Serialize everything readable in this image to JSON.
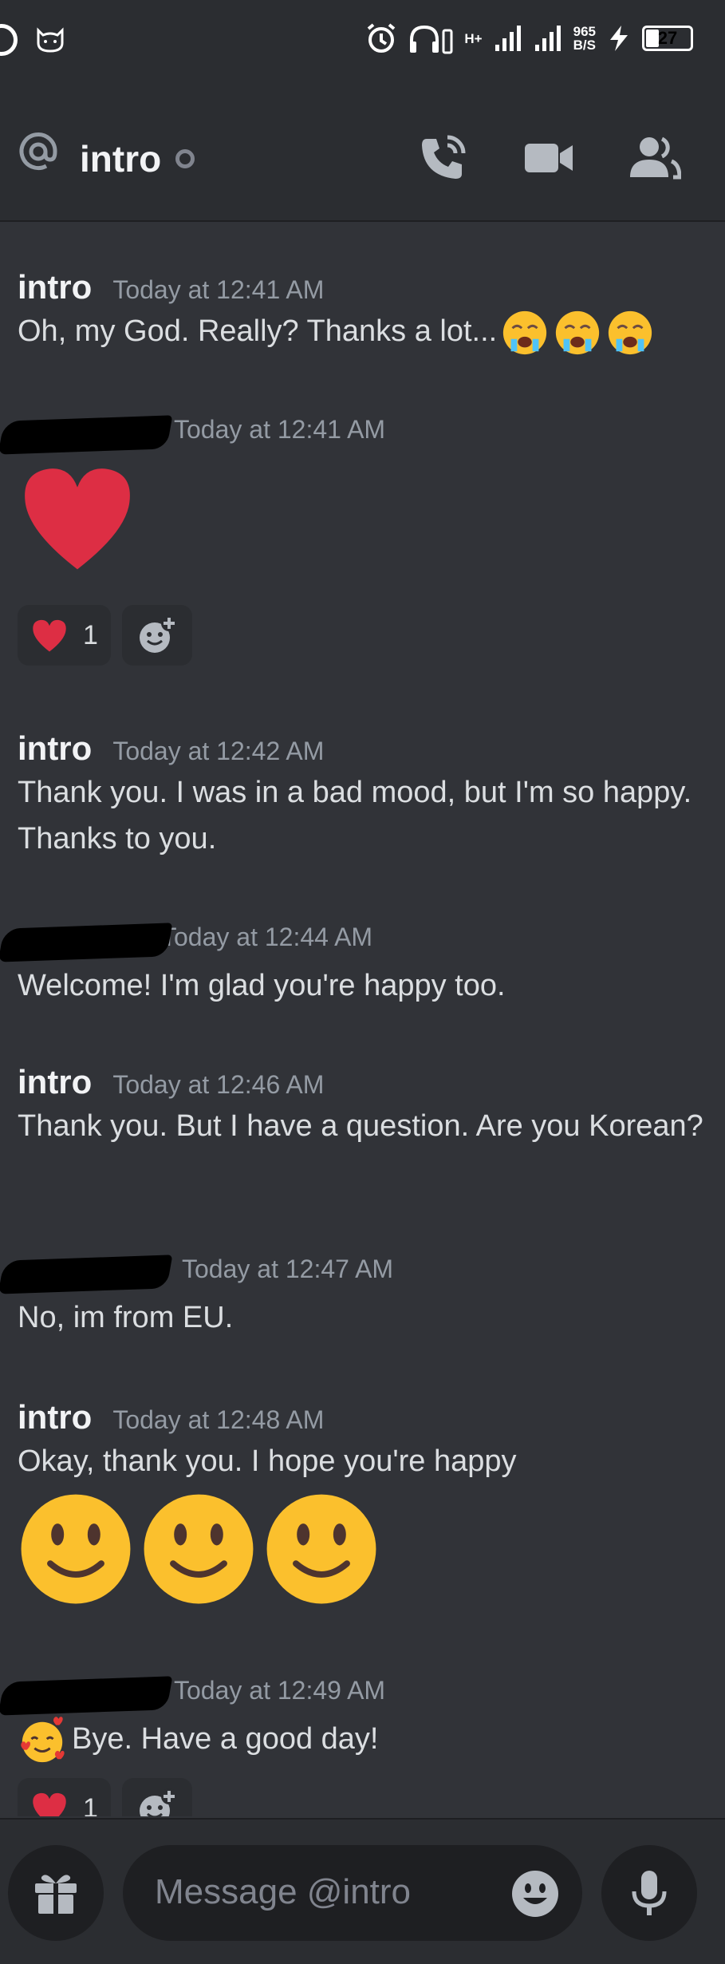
{
  "status_bar": {
    "net_speed": "965",
    "net_unit": "B/S",
    "network_type": "H+",
    "battery": "27"
  },
  "header": {
    "channel_name": "intro"
  },
  "messages": [
    {
      "author": "intro",
      "time": "Today at 12:41 AM",
      "text": "Oh, my God. Really? Thanks a lot...",
      "trailing_emojis": [
        "loudly-crying-face",
        "loudly-crying-face",
        "loudly-crying-face"
      ]
    },
    {
      "author_redacted": true,
      "time": "Today at 12:41 AM",
      "jumbo_emojis": [
        "red-heart"
      ],
      "reactions": [
        {
          "emoji": "red-heart",
          "count": "1"
        }
      ]
    },
    {
      "author": "intro",
      "time": "Today at 12:42 AM",
      "text": "Thank you. I was in a bad mood, but I'm so happy. Thanks to you."
    },
    {
      "author_redacted": true,
      "time": "Today at 12:44 AM",
      "text": "Welcome! I'm glad you're happy too."
    },
    {
      "author": "intro",
      "time": "Today at 12:46 AM",
      "text": "Thank you. But I have a question. Are you Korean?"
    },
    {
      "author_redacted": true,
      "time": "Today at 12:47 AM",
      "text": "No, im from EU."
    },
    {
      "author": "intro",
      "time": "Today at 12:48 AM",
      "text": "Okay, thank you. I hope you're happy",
      "jumbo_emojis": [
        "slightly-smiling-face",
        "slightly-smiling-face",
        "slightly-smiling-face"
      ]
    },
    {
      "author_redacted": true,
      "time": "Today at 12:49 AM",
      "leading_emoji": "smiling-face-with-hearts",
      "text": "Bye. Have a good day!",
      "reactions": [
        {
          "emoji": "red-heart",
          "count": "1"
        }
      ]
    }
  ],
  "composer": {
    "placeholder": "Message @intro"
  },
  "colors": {
    "background": "#313338",
    "header": "#2b2d31",
    "input": "#1e1f22",
    "muted": "#949ba4",
    "heart": "#e8343f"
  }
}
